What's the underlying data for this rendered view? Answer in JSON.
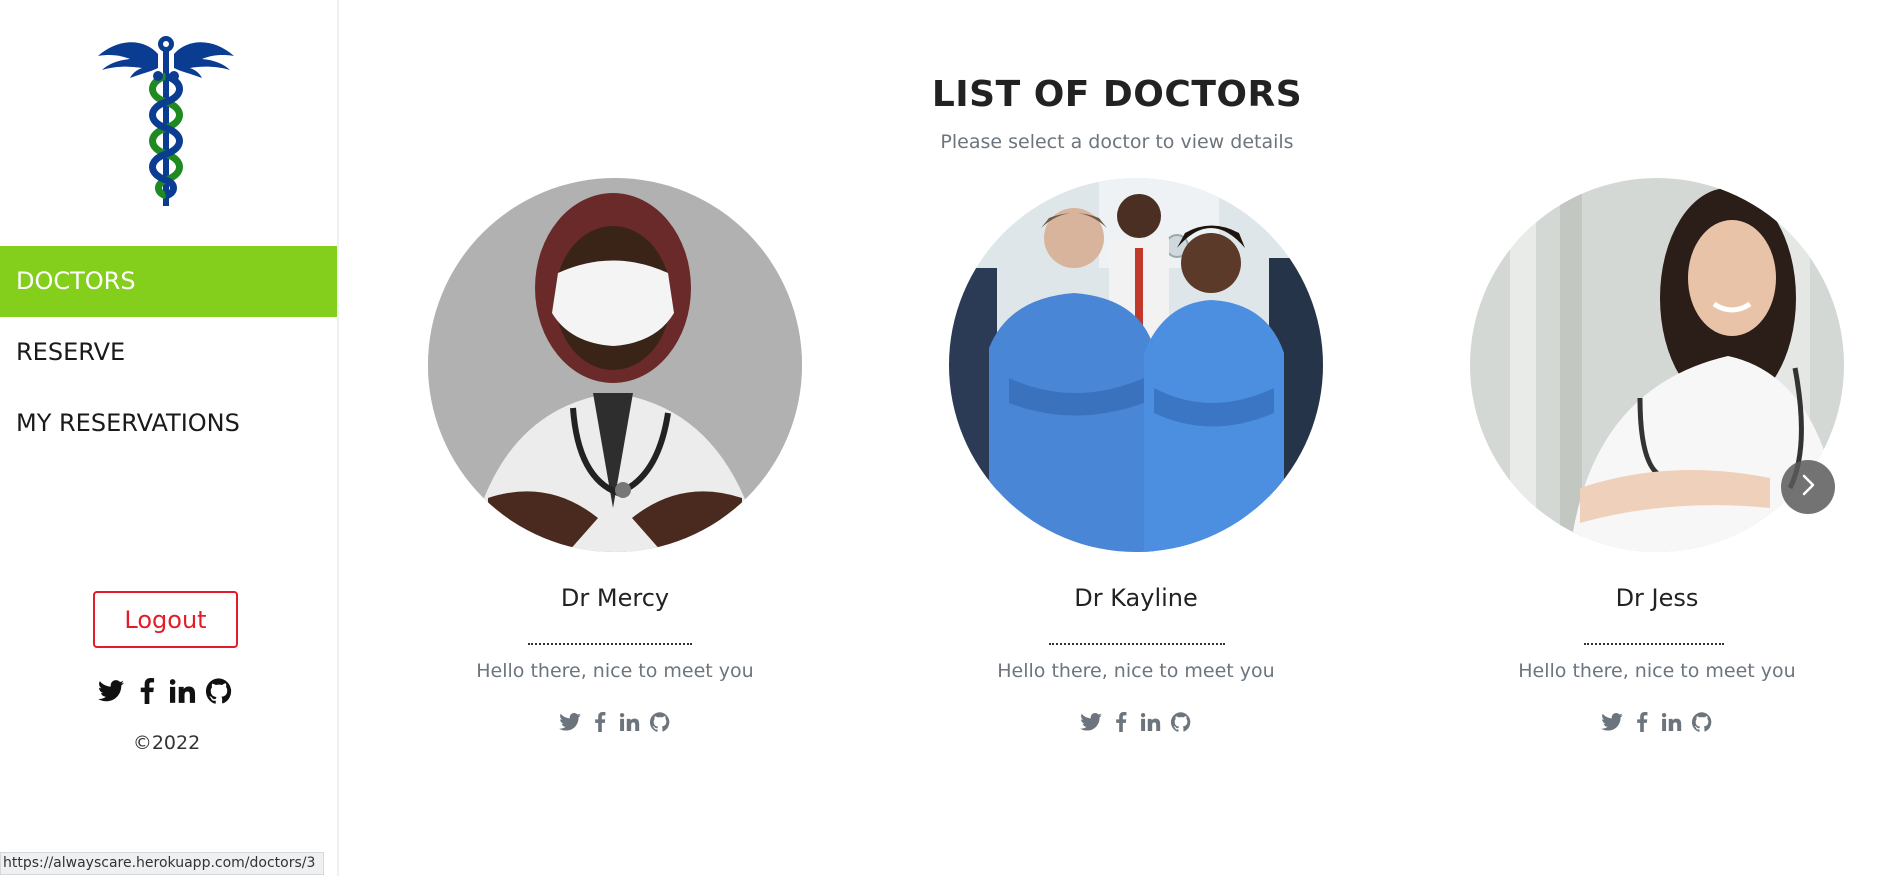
{
  "sidebar": {
    "logo": "caduceus-logo",
    "nav": [
      {
        "label": "DOCTORS",
        "active": true
      },
      {
        "label": "RESERVE",
        "active": false
      },
      {
        "label": "MY RESERVATIONS",
        "active": false
      }
    ],
    "logout_label": "Logout",
    "social_icons": [
      "twitter-icon",
      "facebook-icon",
      "linkedin-icon",
      "github-icon"
    ],
    "copyright": "©2022"
  },
  "status_bar": {
    "url": "https://alwayscare.herokuapp.com/doctors/3"
  },
  "main": {
    "title": "LIST OF DOCTORS",
    "subtitle": "Please select a doctor to view details",
    "doctors": [
      {
        "name": "Dr Mercy",
        "greeting": "Hello there, nice to meet you"
      },
      {
        "name": "Dr Kayline",
        "greeting": "Hello there, nice to meet you"
      },
      {
        "name": "Dr Jess",
        "greeting": "Hello there, nice to meet you"
      }
    ],
    "next_icon": "chevron-right-icon"
  },
  "colors": {
    "accent_green": "#84ce1c",
    "logout_red": "#e11d2a",
    "logo_blue": "#0a3d91",
    "logo_green": "#1f8a21",
    "muted_text": "#6c757d"
  }
}
